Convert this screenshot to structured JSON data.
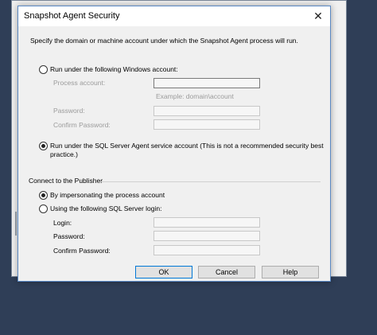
{
  "dialog": {
    "title": "Snapshot Agent Security",
    "close_glyph": "✕",
    "description": "Specify the domain or machine account under which the Snapshot Agent process will run.",
    "run_windows_account": {
      "label": "Run under the following Windows account:",
      "selected": false
    },
    "process_account": {
      "label": "Process account:",
      "value": "",
      "example": "Example: domain\\account"
    },
    "password": {
      "label": "Password:",
      "value": ""
    },
    "confirm_password": {
      "label": "Confirm Password:",
      "value": ""
    },
    "run_sql_agent": {
      "label_line1": "Run under the SQL Server Agent service account (This is not a recommended security best",
      "label_line2": "practice.)",
      "selected": true
    },
    "publisher": {
      "group_title": "Connect to the Publisher",
      "impersonate": {
        "label": "By impersonating the process account",
        "selected": true
      },
      "sql_login": {
        "label": "Using the following SQL Server login:",
        "selected": false
      },
      "login": {
        "label": "Login:",
        "value": ""
      },
      "password": {
        "label": "Password:",
        "value": ""
      },
      "confirm_password": {
        "label": "Confirm Password:",
        "value": ""
      }
    },
    "buttons": {
      "ok": "OK",
      "cancel": "Cancel",
      "help": "Help"
    }
  }
}
